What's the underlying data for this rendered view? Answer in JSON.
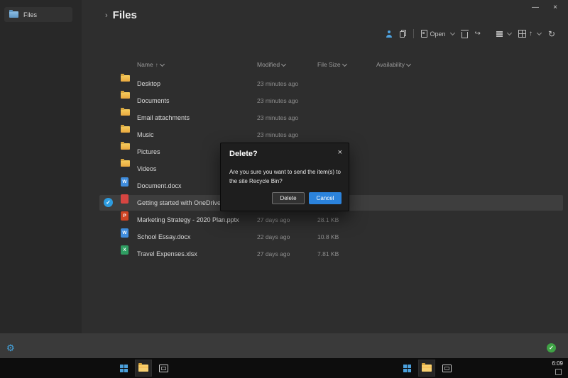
{
  "sidebar": {
    "files_item": {
      "label": "Files"
    }
  },
  "header": {
    "title": "Files"
  },
  "toolbar": {
    "open_label": "Open"
  },
  "table": {
    "columns": {
      "name": "Name",
      "modified": "Modified",
      "size": "File Size",
      "availability": "Availability"
    },
    "rows": [
      {
        "name": "Desktop",
        "type": "folder",
        "badge": "",
        "modified": "23 minutes ago",
        "size": "",
        "availability": "",
        "selected": "false"
      },
      {
        "name": "Documents",
        "type": "folder",
        "badge": "",
        "modified": "23 minutes ago",
        "size": "",
        "availability": "",
        "selected": "false"
      },
      {
        "name": "Email attachments",
        "type": "folder",
        "badge": "",
        "modified": "23 minutes ago",
        "size": "",
        "availability": "",
        "selected": "false"
      },
      {
        "name": "Music",
        "type": "folder",
        "badge": "",
        "modified": "23 minutes ago",
        "size": "",
        "availability": "",
        "selected": "false"
      },
      {
        "name": "Pictures",
        "type": "folder",
        "badge": "",
        "modified": "",
        "size": "",
        "availability": "",
        "selected": "false"
      },
      {
        "name": "Videos",
        "type": "folder",
        "badge": "",
        "modified": "",
        "size": "",
        "availability": "",
        "selected": "false"
      },
      {
        "name": "Document.docx",
        "type": "docx",
        "badge": "W",
        "modified": "",
        "size": "",
        "availability": "",
        "selected": "false"
      },
      {
        "name": "Getting started with OneDrive.pdf",
        "type": "pdf",
        "badge": "",
        "modified": "",
        "size": "",
        "availability": "",
        "selected": "true"
      },
      {
        "name": "Marketing Strategy - 2020 Plan.pptx",
        "type": "pptx",
        "badge": "P",
        "modified": "27 days ago",
        "size": "28.1 KB",
        "availability": "",
        "selected": "false"
      },
      {
        "name": "School Essay.docx",
        "type": "docx",
        "badge": "W",
        "modified": "22 days ago",
        "size": "10.8 KB",
        "availability": "",
        "selected": "false"
      },
      {
        "name": "Travel Expenses.xlsx",
        "type": "xlsx",
        "badge": "X",
        "modified": "27 days ago",
        "size": "7.81 KB",
        "availability": "",
        "selected": "false"
      }
    ]
  },
  "dialog": {
    "title": "Delete?",
    "message": "Are you sure you want to send the item(s) to the site Recycle Bin?",
    "delete_label": "Delete",
    "cancel_label": "Cancel"
  },
  "taskbar": {
    "time": "6:09"
  },
  "icons": {
    "breadcrumb_chevron": "›",
    "sort_ascending": "↑",
    "minimize": "—",
    "close": "×",
    "dialog_close": "×",
    "refresh": "↻",
    "shortcut": "↪",
    "settings_gear": "⚙",
    "check": "✓"
  },
  "colors": {
    "accent_blue": "#2b83dc",
    "folder_yellow": "#f2c14b",
    "success_green": "#3fa345",
    "selected_check_blue": "#2d9ce0"
  }
}
